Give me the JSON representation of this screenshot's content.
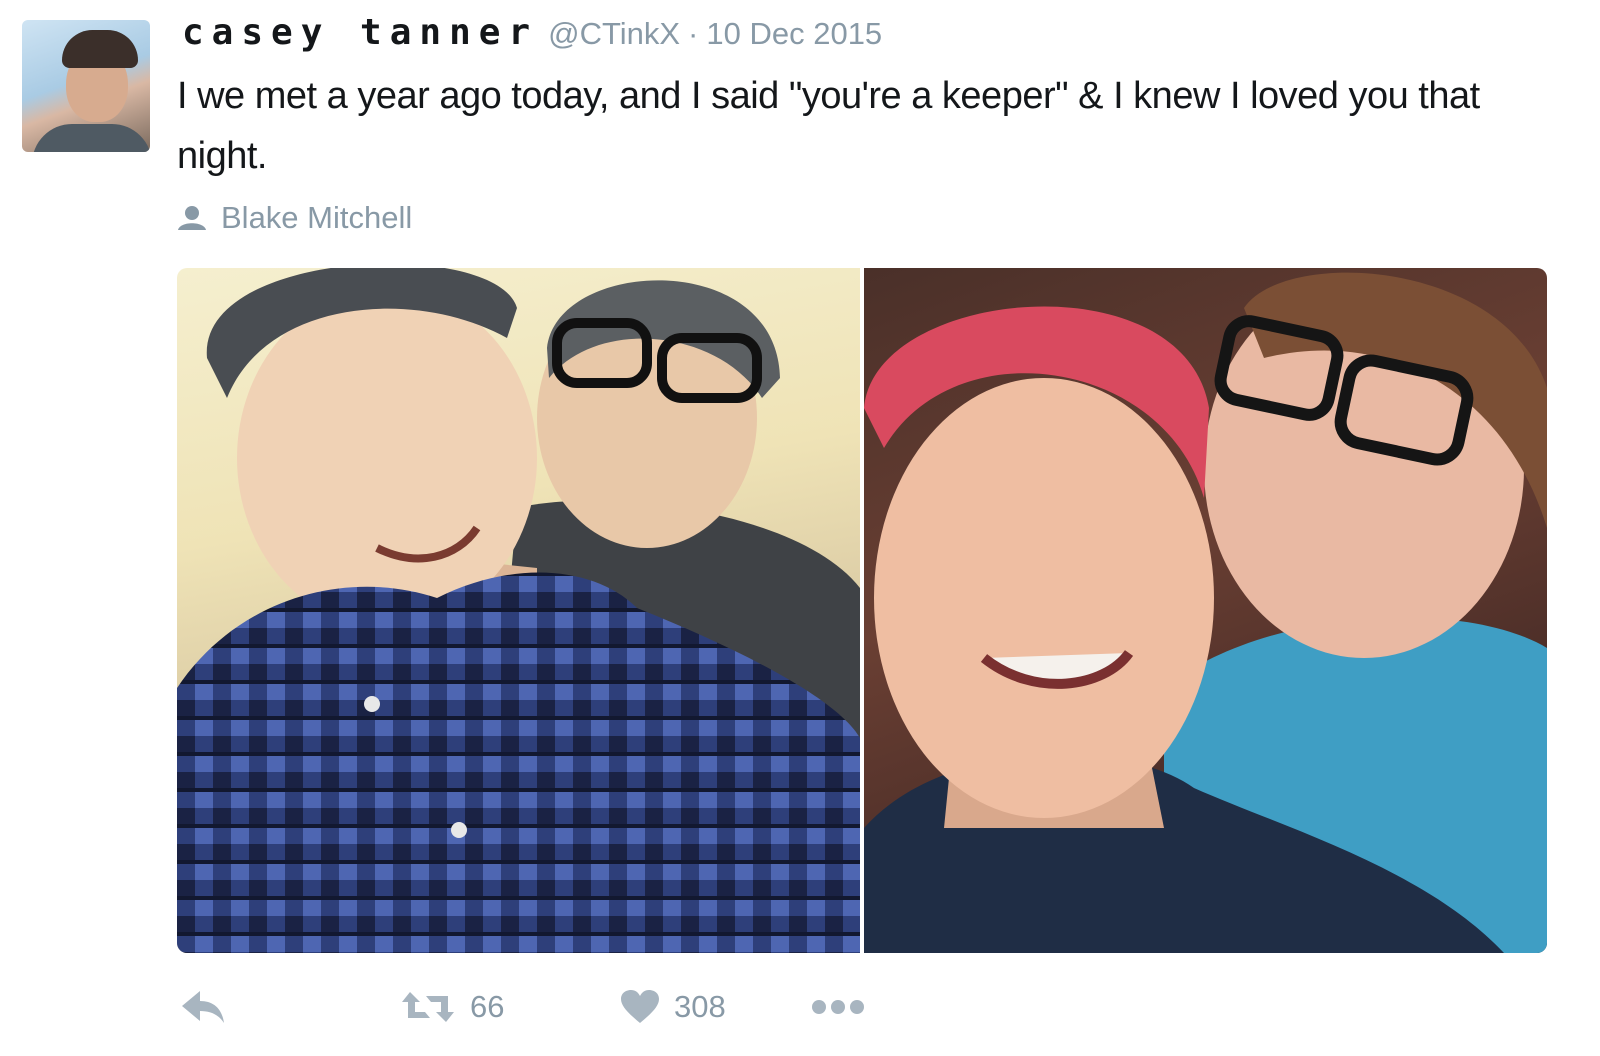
{
  "tweet": {
    "display_name": "casey tanner",
    "handle": "@CTinkX",
    "separator": "·",
    "date": "10 Dec 2015",
    "text": "I we met a year ago today, and I said \"you're a keeper\" & I knew I loved you that night.",
    "tagged_user": "Blake Mitchell"
  },
  "actions": {
    "reply": {
      "icon": "reply-icon"
    },
    "retweet": {
      "icon": "retweet-icon",
      "count": "66"
    },
    "like": {
      "icon": "heart-icon",
      "count": "308"
    },
    "more": {
      "icon": "more-dots-icon"
    }
  },
  "colors": {
    "text": "#14171a",
    "muted": "#8899a6",
    "background": "#ffffff"
  }
}
